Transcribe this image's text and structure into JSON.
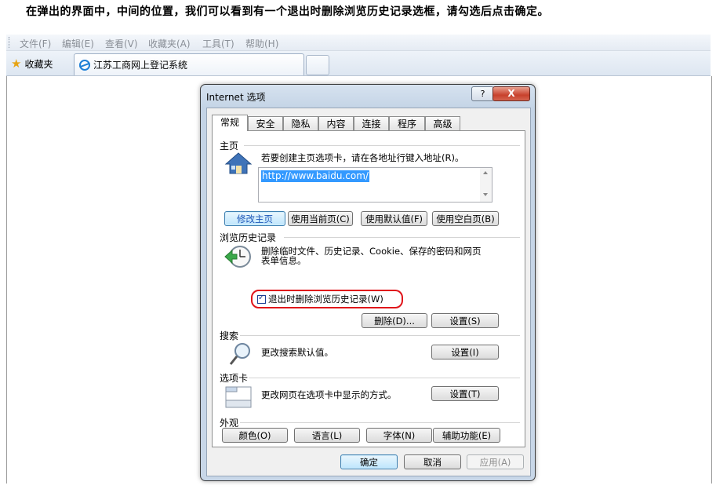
{
  "instruction": "在弹出的界面中，中间的位置，我们可以看到有一个退出时删除浏览历史记录选框，请勾选后点击确定。",
  "menubar": {
    "items": [
      "文件(F)",
      "编辑(E)",
      "查看(V)",
      "收藏夹(A)",
      "工具(T)",
      "帮助(H)"
    ]
  },
  "tabbar": {
    "favorites_label": "收藏夹",
    "active_tab_label": "江苏工商网上登记系统"
  },
  "dialog": {
    "title": "Internet 选项",
    "help_label": "?",
    "close_label": "X",
    "tabs": [
      "常规",
      "安全",
      "隐私",
      "内容",
      "连接",
      "程序",
      "高级"
    ],
    "home": {
      "heading": "主页",
      "desc": "若要创建主页选项卡，请在各地址行键入地址(R)。",
      "url": "http://www.baidu.com/",
      "buttons": [
        "修改主页",
        "使用当前页(C)",
        "使用默认值(F)",
        "使用空白页(B)"
      ]
    },
    "history": {
      "heading": "浏览历史记录",
      "desc_line1": "删除临时文件、历史记录、Cookie、保存的密码和网页",
      "desc_line2": "表单信息。",
      "checkbox_label": "退出时删除浏览历史记录(W)",
      "checkbox_checked": true,
      "delete_label": "删除(D)...",
      "settings_label": "设置(S)"
    },
    "search": {
      "heading": "搜索",
      "desc": "更改搜索默认值。",
      "settings_label": "设置(I)"
    },
    "tabs_section": {
      "heading": "选项卡",
      "desc": "更改网页在选项卡中显示的方式。",
      "settings_label": "设置(T)"
    },
    "appearance": {
      "heading": "外观",
      "buttons": [
        "颜色(O)",
        "语言(L)",
        "字体(N)",
        "辅助功能(E)"
      ]
    },
    "footer": {
      "ok_label": "确定",
      "cancel_label": "取消",
      "apply_label": "应用(A)"
    }
  },
  "colors": {
    "highlight_ring": "#e0141a",
    "selection": "#3399ff",
    "close_button": "#c8412c"
  }
}
